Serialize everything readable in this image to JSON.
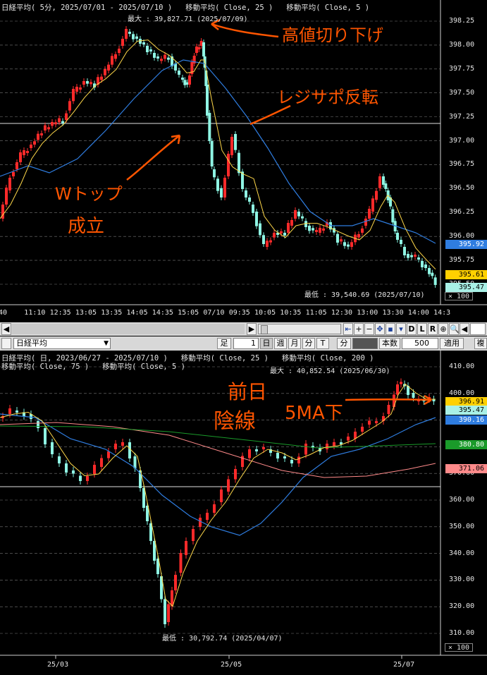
{
  "top_chart": {
    "header": "日経平均( 5分, 2025/07/01 - 2025/07/10 )   移動平均( Close, 25 )   移動平均( Close, 5 )",
    "max_text": "最大 : 39,827.71 (2025/07/09)",
    "min_text": "最低 : 39,540.69 (2025/07/10)",
    "y_ticks": [
      "398.25",
      "398.00",
      "397.75",
      "397.50",
      "397.25",
      "397.00",
      "396.75",
      "396.50",
      "396.25",
      "396.00",
      "395.75",
      "395.50"
    ],
    "x_ticks": [
      "40",
      "11:10",
      "12:35",
      "13:05",
      "13:35",
      "14:05",
      "14:35",
      "15:05",
      "07/10",
      "09:35",
      "10:05",
      "10:35",
      "11:05",
      "12:30",
      "13:00",
      "13:30",
      "14:00",
      "14:3"
    ],
    "price_labels": [
      {
        "text": "395.92",
        "color": "#2f7de0"
      },
      {
        "text": "395.61",
        "color": "#ffd000"
      },
      {
        "text": "395.47",
        "color": "#a8f0e6"
      }
    ],
    "zoom": "× 100",
    "annotations": [
      "高値切り下げ",
      "レジサポ反転",
      "Wトップ",
      "成立"
    ]
  },
  "scrollbar": {
    "buttons": [
      "◀",
      "▶",
      "⇤",
      "+",
      "−",
      "✥",
      "▪",
      "▾",
      "D",
      "L",
      "R",
      "⊕",
      "🔍",
      "◀"
    ]
  },
  "toolbar": {
    "symbol": "日経平均",
    "items": [
      "足",
      "1",
      "日",
      "週",
      "月",
      "分",
      "T",
      "分",
      "",
      "本数",
      "500",
      "適用",
      "複"
    ]
  },
  "bottom_chart": {
    "header1": "日経平均( 日, 2023/06/27 - 2025/07/10 )   移動平均( Close, 25 )   移動平均( Close, 200 )",
    "header2": "移動平均( Close, 75 )   移動平均( Close, 5 )",
    "max_text": "最大 : 40,852.54 (2025/06/30)",
    "min_text": "最低 : 30,792.74 (2025/04/07)",
    "y_ticks": [
      "410.00",
      "400.00",
      "390.00",
      "380.00",
      "370.00",
      "360.00",
      "350.00",
      "340.00",
      "330.00",
      "320.00",
      "310.00"
    ],
    "x_ticks": [
      "25/03",
      "25/05",
      "25/07"
    ],
    "price_labels": [
      {
        "text": "396.91",
        "color": "#ffd000"
      },
      {
        "text": "395.47",
        "color": "#a8f0e6"
      },
      {
        "text": "390.16",
        "color": "#2f7de0"
      },
      {
        "text": "380.80",
        "color": "#1a9a2a"
      },
      {
        "text": "371.06",
        "color": "#ff8a8a"
      }
    ],
    "zoom": "× 100",
    "annotations": [
      "前日",
      "陰線",
      "5MA下"
    ]
  }
}
